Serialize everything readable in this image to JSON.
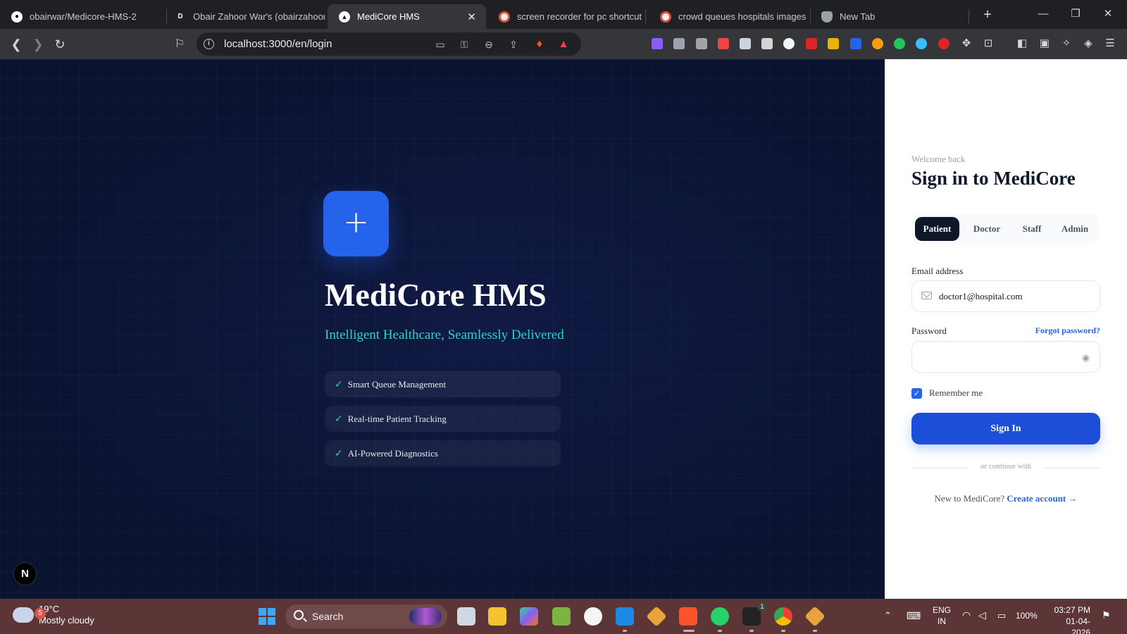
{
  "browser": {
    "tabs": [
      {
        "title": "obairwar/Medicore-HMS-2",
        "favicon": "github-icon",
        "active": false
      },
      {
        "title": "Obair Zahoor War's (obairzahoor",
        "favicon": "d-icon",
        "active": false
      },
      {
        "title": "MediCore HMS",
        "favicon": "triangle-icon",
        "active": true
      },
      {
        "title": "screen recorder for pc shortcut",
        "favicon": "brave-icon",
        "active": false
      },
      {
        "title": "crowd queues hospitals images",
        "favicon": "brave-icon",
        "active": false
      },
      {
        "title": "New Tab",
        "favicon": "shield-icon",
        "active": false
      }
    ],
    "url": "localhost:3000/en/login"
  },
  "hero": {
    "logo_symbol": "+",
    "title": "MediCore HMS",
    "subtitle": "Intelligent Healthcare, Seamlessly Delivered",
    "check_symbol": "✓",
    "features": [
      "Smart Queue Management",
      "Real-time Patient Tracking",
      "AI-Powered Diagnostics"
    ],
    "next_badge": "N"
  },
  "login": {
    "welcome": "Welcome back",
    "title": "Sign in to MediCore",
    "roles": [
      "Patient",
      "Doctor",
      "Staff",
      "Admin"
    ],
    "active_role": "Patient",
    "email_label": "Email address",
    "email_value": "doctor1@hospital.com",
    "password_label": "Password",
    "forgot": "Forgot password?",
    "password_value": "",
    "remember_label": "Remember me",
    "remember_checked": true,
    "signin_label": "Sign In",
    "divider_text": "or continue with",
    "new_prefix": "New to MediCore?",
    "create_link": "Create account →"
  },
  "taskbar": {
    "weather_badge": "5",
    "weather_temp": "19°C",
    "weather_desc": "Mostly cloudy",
    "search_label": "Search",
    "lang_top": "ENG",
    "lang_bottom": "IN",
    "battery": "100%",
    "time": "03:27 PM",
    "date": "01-04-2026",
    "notification_badge": "1"
  },
  "colors": {
    "hero_bg": "#0c1633",
    "accent_blue": "#2563eb",
    "teal": "#2dd4bf",
    "dark_navy": "#0f172a",
    "taskbar": "#5c3536"
  }
}
